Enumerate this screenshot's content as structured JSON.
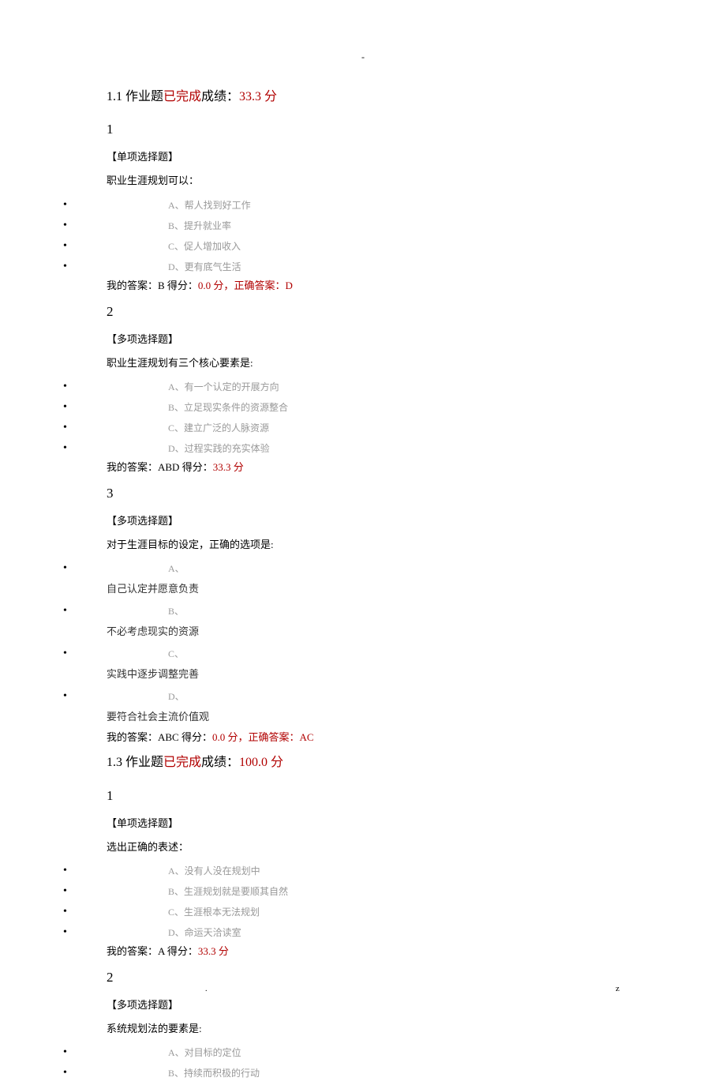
{
  "top_dash": "-",
  "sections": [
    {
      "header_title": "1.1 作业题",
      "completed": "已完成",
      "score_label": "成绩：",
      "score_value": "33.3 分",
      "questions": [
        {
          "num": "1",
          "type": "【单项选择题】",
          "text": "职业生涯规划可以：",
          "multiline": false,
          "options": [
            {
              "letter": "A、",
              "text": "帮人找到好工作"
            },
            {
              "letter": "B、",
              "text": "提升就业率"
            },
            {
              "letter": "C、",
              "text": "促人增加收入"
            },
            {
              "letter": "D、",
              "text": "更有底气生活"
            }
          ],
          "answer": {
            "prefix": "我的答案：B 得分：",
            "score": "0.0 分，",
            "correct_label": "正确答案：D"
          }
        },
        {
          "num": "2",
          "type": "【多项选择题】",
          "text": "职业生涯规划有三个核心要素是:",
          "multiline": false,
          "options": [
            {
              "letter": "A、",
              "text": "有一个认定的开展方向"
            },
            {
              "letter": "B、",
              "text": "立足现实条件的资源整合"
            },
            {
              "letter": "C、",
              "text": "建立广泛的人脉资源"
            },
            {
              "letter": "D、",
              "text": "过程实践的充实体验"
            }
          ],
          "answer": {
            "prefix": "我的答案：ABD 得分：",
            "score": "33.3 分",
            "correct_label": ""
          }
        },
        {
          "num": "3",
          "type": "【多项选择题】",
          "text": "对于生涯目标的设定，正确的选项是:",
          "multiline": true,
          "options": [
            {
              "letter": "A、",
              "text": "自己认定并愿意负责"
            },
            {
              "letter": "B、",
              "text": "不必考虑现实的资源"
            },
            {
              "letter": "C、",
              "text": "实践中逐步调整完善"
            },
            {
              "letter": "D、",
              "text": "要符合社会主流价值观"
            }
          ],
          "answer": {
            "prefix": "我的答案：ABC 得分：",
            "score": "0.0 分，",
            "correct_label": "正确答案：AC"
          }
        }
      ]
    },
    {
      "header_title": "1.3 作业题",
      "completed": "已完成",
      "score_label": "成绩：",
      "score_value": "100.0 分",
      "questions": [
        {
          "num": "1",
          "type": "【单项选择题】",
          "text": "选出正确的表述：",
          "multiline": false,
          "options": [
            {
              "letter": "A、",
              "text": "没有人没在规划中"
            },
            {
              "letter": "B、",
              "text": "生涯规划就是要顺其自然"
            },
            {
              "letter": "C、",
              "text": "生涯根本无法规划"
            },
            {
              "letter": "D、",
              "text": "命运天洽读室"
            }
          ],
          "answer": {
            "prefix": "我的答案：A 得分：",
            "score": "33.3 分",
            "correct_label": ""
          }
        },
        {
          "num": "2",
          "type": "【多项选择题】",
          "text": "系统规划法的要素是:",
          "multiline": false,
          "options": [
            {
              "letter": "A、",
              "text": "对目标的定位"
            },
            {
              "letter": "B、",
              "text": "持续而积极的行动"
            }
          ],
          "answer": null
        }
      ]
    }
  ],
  "footer_dot": ".",
  "footer_z": "z"
}
